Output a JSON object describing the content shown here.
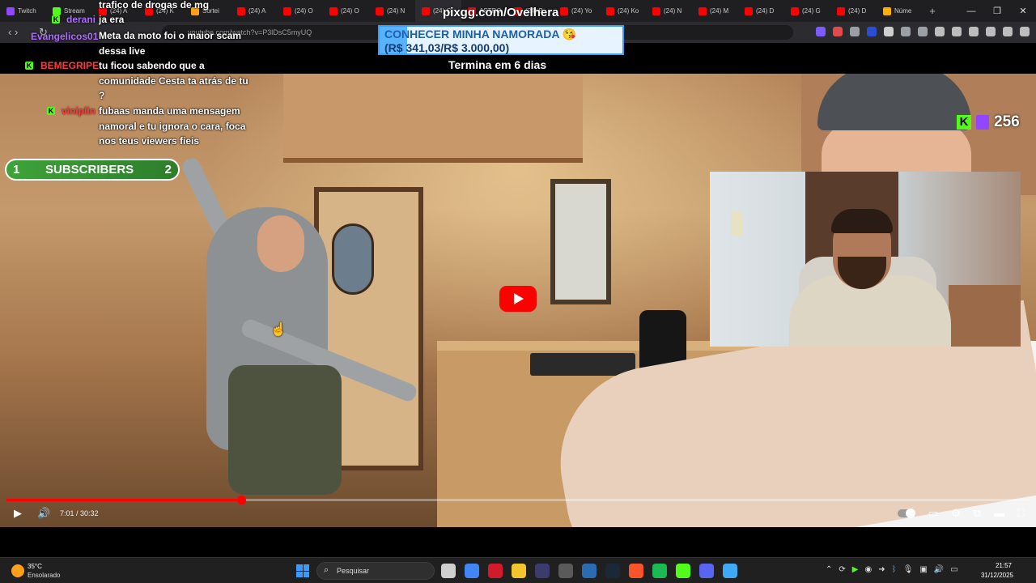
{
  "browser": {
    "tabs": [
      {
        "label": "Twitch",
        "color": "#9146ff"
      },
      {
        "label": "Stream",
        "color": "#53fc18"
      },
      {
        "label": "(24) A",
        "color": "#ff0000"
      },
      {
        "label": "(24) K",
        "color": "#ff0000"
      },
      {
        "label": "Sortei",
        "color": "#ff9f1a"
      },
      {
        "label": "(24) A",
        "color": "#ff0000"
      },
      {
        "label": "(24) O",
        "color": "#ff0000"
      },
      {
        "label": "(24) O",
        "color": "#ff0000"
      },
      {
        "label": "(24) N",
        "color": "#ff0000"
      },
      {
        "label": "(24) C",
        "color": "#ff0000"
      },
      {
        "label": "ASTRO",
        "color": "#ff0000"
      },
      {
        "label": "(24) B",
        "color": "#ff0000"
      },
      {
        "label": "(24) Yo",
        "color": "#ff0000"
      },
      {
        "label": "(24) Ko",
        "color": "#ff0000"
      },
      {
        "label": "(24) N",
        "color": "#ff0000"
      },
      {
        "label": "(24) M",
        "color": "#ff0000"
      },
      {
        "label": "(24) D",
        "color": "#ff0000"
      },
      {
        "label": "(24) G",
        "color": "#ff0000"
      },
      {
        "label": "(24) D",
        "color": "#ff0000"
      },
      {
        "label": "Núme",
        "color": "#ffb000"
      }
    ],
    "active_tab_index": 9,
    "new_tab_icon": "+",
    "window_controls": [
      "—",
      "❐",
      "✕"
    ],
    "url": "youtube.com/watch?v=P3lDsC5myUQ"
  },
  "player": {
    "current_time": "7:01",
    "duration": "30:32",
    "time_display": "7:01 / 30:32",
    "progress_fraction": 0.2298
  },
  "chat": [
    {
      "user": "",
      "message": "trafico de drogas de mg",
      "user_color": "#ffffff",
      "badge": false
    },
    {
      "user": "derani",
      "message": "ja era",
      "user_color": "#b06cff",
      "badge": true
    },
    {
      "user": "Evangelicos01",
      "message": "Meta da moto foi o maior scam dessa live",
      "user_color": "#b06cff",
      "badge": false
    },
    {
      "user": "BEMEGRIPE",
      "message": "tu ficou sabendo que a comunidade Cesta ta atrás de tu ?",
      "user_color": "#ff3b3b",
      "badge": true
    },
    {
      "user": "viniplin",
      "message": "fubaas manda uma mensagem namoral e tu ignora o cara, foca nos teus viewers fieis",
      "user_color": "#ff3b3b",
      "badge": true
    }
  ],
  "subscribers": {
    "left": "1",
    "label": "SUBSCRIBERS",
    "right": "2"
  },
  "pix": {
    "title": "pixgg.com/Ovelhera",
    "goal": "CONHECER MINHA NAMORADA 😘",
    "amount": "(R$ 341,03/R$ 3.000,00)",
    "ends": "Termina em 6 dias",
    "progress_fraction": 0.1137
  },
  "viewers": {
    "count": "256"
  },
  "taskbar": {
    "weather_temp": "35°C",
    "weather_desc": "Ensolarado",
    "search_placeholder": "Pesquisar",
    "clock_time": "21:57",
    "clock_date": "31/12/2025"
  },
  "colors": {
    "kick_green": "#53fc18",
    "twitch_purple": "#9146ff",
    "youtube_red": "#ff0000"
  }
}
